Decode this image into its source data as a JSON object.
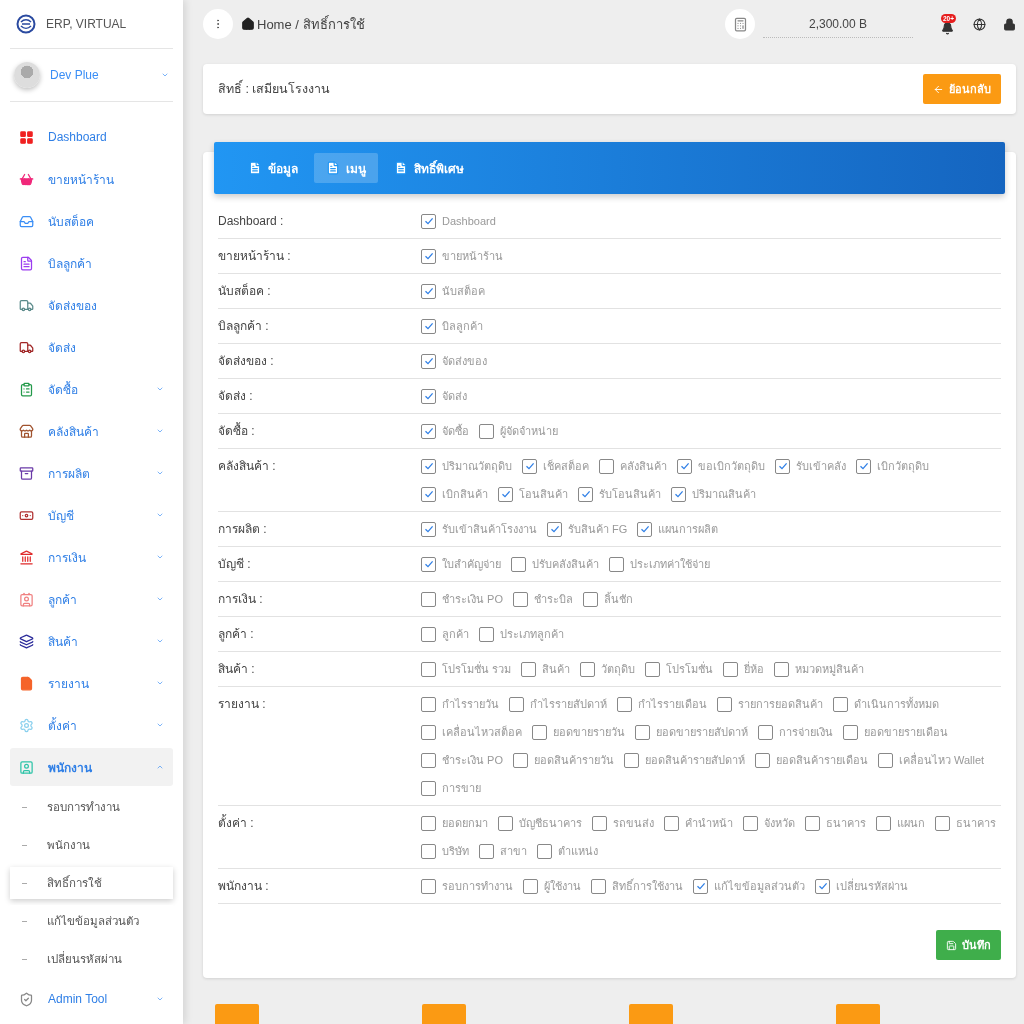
{
  "sidebar": {
    "brand": "ERP, VIRTUAL",
    "user": {
      "name": "Dev Plue"
    },
    "items": [
      {
        "label": "Dashboard",
        "selected": false
      },
      {
        "label": "ขายหน้าร้าน",
        "selected": false
      },
      {
        "label": "นับสต็อค",
        "selected": false
      },
      {
        "label": "บิลลูกค้า",
        "selected": false
      },
      {
        "label": "จัดส่งของ",
        "selected": false
      },
      {
        "label": "จัดส่ง",
        "selected": false
      },
      {
        "label": "จัดซื้อ",
        "selected": false,
        "expanded": false
      },
      {
        "label": "คลังสินค้า",
        "selected": false,
        "expanded": false
      },
      {
        "label": "การผลิต",
        "selected": false,
        "expanded": false
      },
      {
        "label": "บัญชี",
        "selected": false,
        "expanded": false
      },
      {
        "label": "การเงิน",
        "selected": false,
        "expanded": false
      },
      {
        "label": "ลูกค้า",
        "selected": false,
        "expanded": false
      },
      {
        "label": "สินค้า",
        "selected": false,
        "expanded": false
      },
      {
        "label": "รายงาน",
        "selected": false,
        "expanded": false
      },
      {
        "label": "ตั้งค่า",
        "selected": false,
        "expanded": false
      },
      {
        "label": "พนักงาน",
        "selected": true,
        "expanded": true,
        "children": [
          {
            "label": "รอบการทำงาน",
            "selected": false
          },
          {
            "label": "พนักงาน",
            "selected": false
          },
          {
            "label": "สิทธิ์การใช้",
            "selected": true
          },
          {
            "label": "แก้ไขข้อมูลส่วนตัว",
            "selected": false
          },
          {
            "label": "เปลี่ยนรหัสผ่าน",
            "selected": false
          }
        ]
      },
      {
        "label": "Admin Tool",
        "selected": false,
        "expanded": false
      }
    ]
  },
  "topbar": {
    "breadcrumb": "Home / สิทธิ์การใช้",
    "balance": "2,300.00 B",
    "notification_badge": "20+"
  },
  "header_card": {
    "title": "สิทธิ์ : เสมียนโรงงาน",
    "back_button": "ย้อนกลับ"
  },
  "tabs": [
    {
      "label": "ข้อมูล",
      "selected": false
    },
    {
      "label": "เมนู",
      "selected": true
    },
    {
      "label": "สิทธิ์พิเศษ",
      "selected": false
    }
  ],
  "permissions": [
    {
      "label": "Dashboard :",
      "options": [
        {
          "label": "Dashboard",
          "checked": true
        }
      ]
    },
    {
      "label": "ขายหน้าร้าน :",
      "options": [
        {
          "label": "ขายหน้าร้าน",
          "checked": true
        }
      ]
    },
    {
      "label": "นับสต็อค :",
      "options": [
        {
          "label": "นับสต็อค",
          "checked": true
        }
      ]
    },
    {
      "label": "บิลลูกค้า :",
      "options": [
        {
          "label": "บิลลูกค้า",
          "checked": true
        }
      ]
    },
    {
      "label": "จัดส่งของ :",
      "options": [
        {
          "label": "จัดส่งของ",
          "checked": true
        }
      ]
    },
    {
      "label": "จัดส่ง :",
      "options": [
        {
          "label": "จัดส่ง",
          "checked": true
        }
      ]
    },
    {
      "label": "จัดซื้อ :",
      "options": [
        {
          "label": "จัดซื้อ",
          "checked": true
        },
        {
          "label": "ผู้จัดจำหน่าย",
          "checked": false
        }
      ]
    },
    {
      "label": "คลังสินค้า :",
      "options": [
        {
          "label": "ปริมาณวัตถุดิบ",
          "checked": true
        },
        {
          "label": "เช็คสต็อค",
          "checked": true
        },
        {
          "label": "คลังสินค้า",
          "checked": false
        },
        {
          "label": "ขอเบิกวัตถุดิบ",
          "checked": true
        },
        {
          "label": "รับเข้าคลัง",
          "checked": true
        },
        {
          "label": "เบิกวัตถุดิบ",
          "checked": true
        },
        {
          "label": "เบิกสินค้า",
          "checked": true
        },
        {
          "label": "โอนสินค้า",
          "checked": true
        },
        {
          "label": "รับโอนสินค้า",
          "checked": true
        },
        {
          "label": "ปริมาณสินค้า",
          "checked": true
        }
      ]
    },
    {
      "label": "การผลิต :",
      "options": [
        {
          "label": "รับเข้าสินค้าโรงงาน",
          "checked": true
        },
        {
          "label": "รับสินค้า FG",
          "checked": true
        },
        {
          "label": "แผนการผลิต",
          "checked": true
        }
      ]
    },
    {
      "label": "บัญชี :",
      "options": [
        {
          "label": "ใบสำคัญจ่าย",
          "checked": true
        },
        {
          "label": "ปรับคลังสินค้า",
          "checked": false
        },
        {
          "label": "ประเภทค่าใช้จ่าย",
          "checked": false
        }
      ]
    },
    {
      "label": "การเงิน :",
      "options": [
        {
          "label": "ชำระเงิน PO",
          "checked": false
        },
        {
          "label": "ชำระบิล",
          "checked": false
        },
        {
          "label": "ลิ้นชัก",
          "checked": false
        }
      ]
    },
    {
      "label": "ลูกค้า :",
      "options": [
        {
          "label": "ลูกค้า",
          "checked": false
        },
        {
          "label": "ประเภทลูกค้า",
          "checked": false
        }
      ]
    },
    {
      "label": "สินค้า :",
      "options": [
        {
          "label": "โปรโมชั่น รวม",
          "checked": false
        },
        {
          "label": "สินค้า",
          "checked": false
        },
        {
          "label": "วัตถุดิบ",
          "checked": false
        },
        {
          "label": "โปรโมชั่น",
          "checked": false
        },
        {
          "label": "ยี่ห้อ",
          "checked": false
        },
        {
          "label": "หมวดหมู่สินค้า",
          "checked": false
        }
      ]
    },
    {
      "label": "รายงาน :",
      "options": [
        {
          "label": "กำไรรายวัน",
          "checked": false
        },
        {
          "label": "กำไรรายสัปดาห์",
          "checked": false
        },
        {
          "label": "กำไรรายเดือน",
          "checked": false
        },
        {
          "label": "รายการยอดสินค้า",
          "checked": false
        },
        {
          "label": "ดำเนินการทั้งหมด",
          "checked": false
        },
        {
          "label": "เคลื่อนไหวสต็อค",
          "checked": false
        },
        {
          "label": "ยอดขายรายวัน",
          "checked": false
        },
        {
          "label": "ยอดขายรายสัปดาห์",
          "checked": false
        },
        {
          "label": "การจ่ายเงิน",
          "checked": false
        },
        {
          "label": "ยอดขายรายเดือน",
          "checked": false
        },
        {
          "label": "ชำระเงิน PO",
          "checked": false
        },
        {
          "label": "ยอดสินค้ารายวัน",
          "checked": false
        },
        {
          "label": "ยอดสินค้ารายสัปดาห์",
          "checked": false
        },
        {
          "label": "ยอดสินค้ารายเดือน",
          "checked": false
        },
        {
          "label": "เคลื่อนไหว Wallet",
          "checked": false
        },
        {
          "label": "การขาย",
          "checked": false
        }
      ]
    },
    {
      "label": "ตั้งค่า :",
      "options": [
        {
          "label": "ยอดยกมา",
          "checked": false
        },
        {
          "label": "บัญชีธนาคาร",
          "checked": false
        },
        {
          "label": "รถขนส่ง",
          "checked": false
        },
        {
          "label": "คำนำหน้า",
          "checked": false
        },
        {
          "label": "จังหวัด",
          "checked": false
        },
        {
          "label": "ธนาคาร",
          "checked": false
        },
        {
          "label": "แผนก",
          "checked": false
        },
        {
          "label": "ธนาคาร",
          "checked": false
        },
        {
          "label": "บริษัท",
          "checked": false
        },
        {
          "label": "สาขา",
          "checked": false
        },
        {
          "label": "ตำแหน่ง",
          "checked": false
        }
      ]
    },
    {
      "label": "พนักงาน :",
      "options": [
        {
          "label": "รอบการทำงาน",
          "checked": false
        },
        {
          "label": "ผู้ใช้งาน",
          "checked": false
        },
        {
          "label": "สิทธิ์การใช้งาน",
          "checked": false
        },
        {
          "label": "แก้ไขข้อมูลส่วนตัว",
          "checked": true
        },
        {
          "label": "เปลี่ยนรหัสผ่าน",
          "checked": true
        }
      ]
    }
  ],
  "save_button": "บันทึก"
}
